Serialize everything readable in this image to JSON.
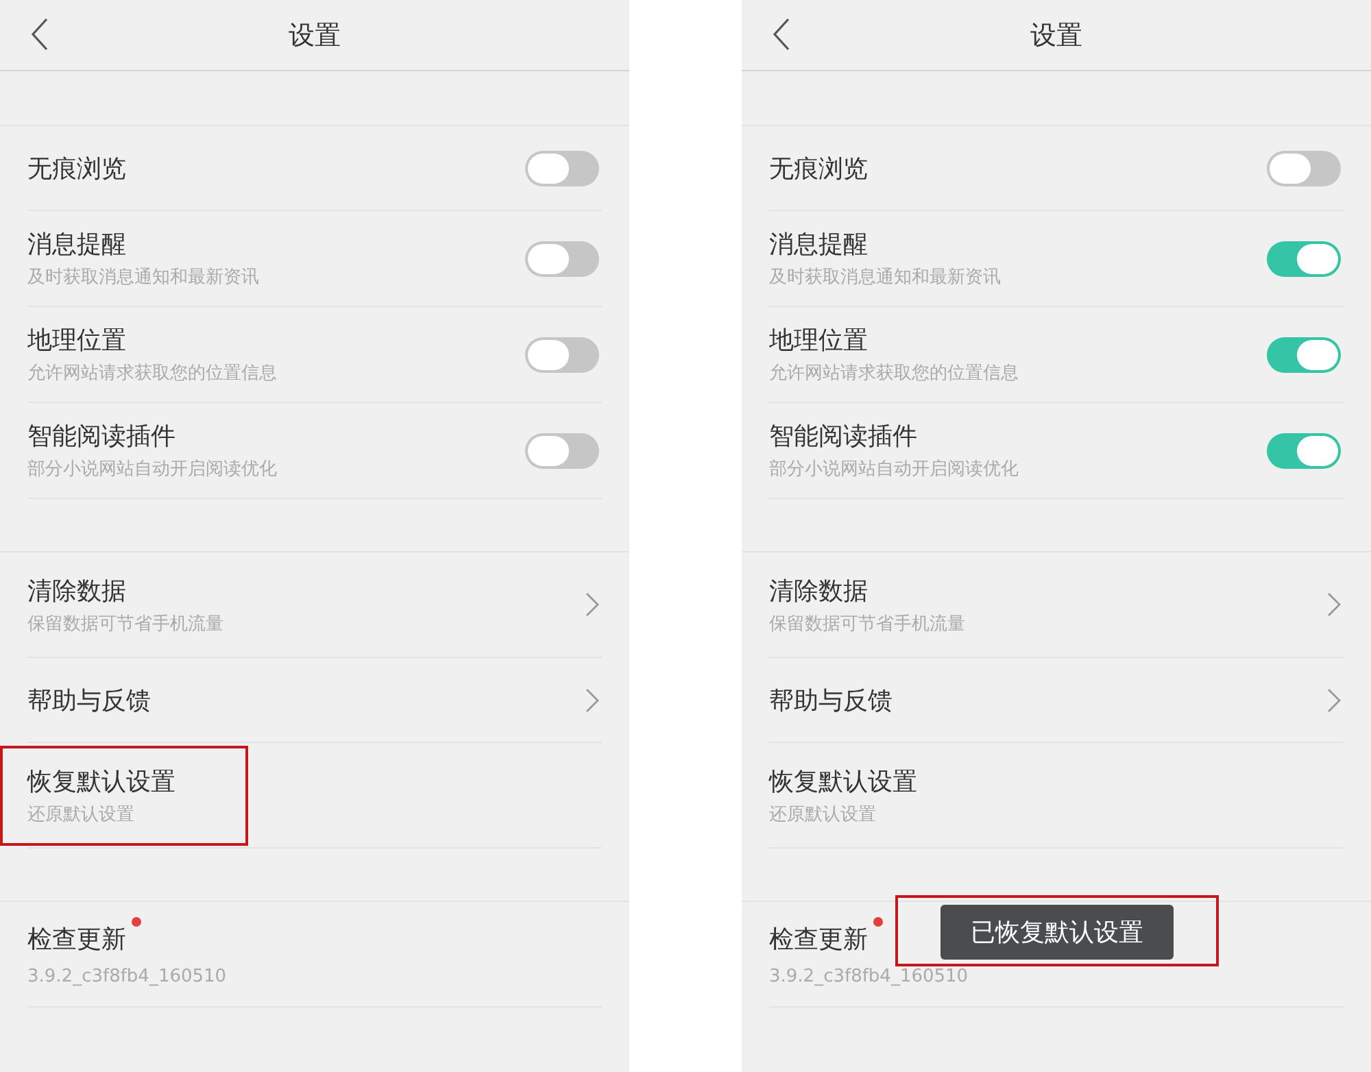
{
  "screens": [
    {
      "title": "设置",
      "groups": [
        {
          "rows": [
            {
              "kind": "toggle",
              "title": "无痕浏览",
              "on": false
            },
            {
              "kind": "toggle",
              "title": "消息提醒",
              "subtitle": "及时获取消息通知和最新资讯",
              "on": false
            },
            {
              "kind": "toggle",
              "title": "地理位置",
              "subtitle": "允许网站请求获取您的位置信息",
              "on": false
            },
            {
              "kind": "toggle",
              "title": "智能阅读插件",
              "subtitle": "部分小说网站自动开启阅读优化",
              "on": false
            }
          ]
        },
        {
          "rows": [
            {
              "kind": "link",
              "title": "清除数据",
              "subtitle": "保留数据可节省手机流量",
              "highlighted": false
            },
            {
              "kind": "link",
              "title": "帮助与反馈",
              "highlighted": false
            },
            {
              "kind": "plain",
              "title": "恢复默认设置",
              "subtitle": "还原默认设置",
              "highlighted": true
            }
          ]
        },
        {
          "rows": [
            {
              "kind": "update",
              "title": "检查更新",
              "subtitle": "3.9.2_c3f8fb4_160510",
              "new_badge": true
            }
          ]
        }
      ]
    },
    {
      "title": "设置",
      "groups": [
        {
          "rows": [
            {
              "kind": "toggle",
              "title": "无痕浏览",
              "on": false
            },
            {
              "kind": "toggle",
              "title": "消息提醒",
              "subtitle": "及时获取消息通知和最新资讯",
              "on": true
            },
            {
              "kind": "toggle",
              "title": "地理位置",
              "subtitle": "允许网站请求获取您的位置信息",
              "on": true
            },
            {
              "kind": "toggle",
              "title": "智能阅读插件",
              "subtitle": "部分小说网站自动开启阅读优化",
              "on": true
            }
          ]
        },
        {
          "rows": [
            {
              "kind": "link",
              "title": "清除数据",
              "subtitle": "保留数据可节省手机流量",
              "highlighted": false
            },
            {
              "kind": "link",
              "title": "帮助与反馈",
              "highlighted": false
            },
            {
              "kind": "plain",
              "title": "恢复默认设置",
              "subtitle": "还原默认设置",
              "highlighted": false
            }
          ]
        },
        {
          "rows": [
            {
              "kind": "update",
              "title": "检查更新",
              "subtitle": "3.9.2_c3f8fb4_160510",
              "new_badge": true
            }
          ]
        }
      ],
      "toast": {
        "text": "已恢复默认设置",
        "highlighted": true
      }
    }
  ]
}
